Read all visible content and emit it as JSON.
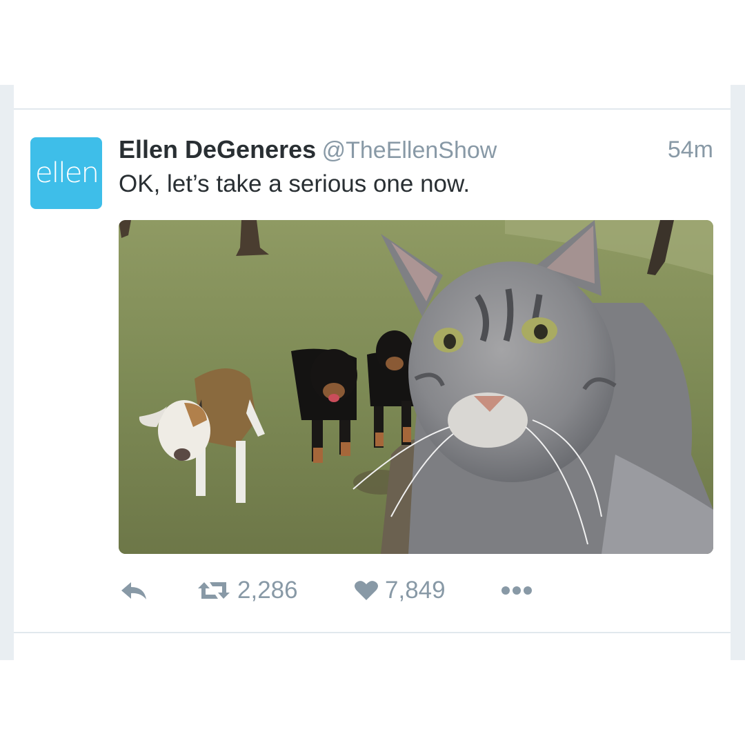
{
  "tweet": {
    "avatar_text": "ellen",
    "name": "Ellen DeGeneres",
    "handle": "@TheEllenShow",
    "time": "54m",
    "text": "OK, let’s take a serious one now.",
    "media_icon": "photo-selfie-cat-dogs"
  },
  "actions": {
    "reply_icon": "reply-icon",
    "retweet_icon": "retweet-icon",
    "retweet_count": "2,286",
    "like_icon": "heart-icon",
    "like_count": "7,849",
    "more_icon": "more-dots-icon"
  },
  "colors": {
    "avatar_bg": "#3ebee9",
    "name": "#292f33",
    "muted": "#8899a6",
    "divider": "#e1e8ed"
  }
}
